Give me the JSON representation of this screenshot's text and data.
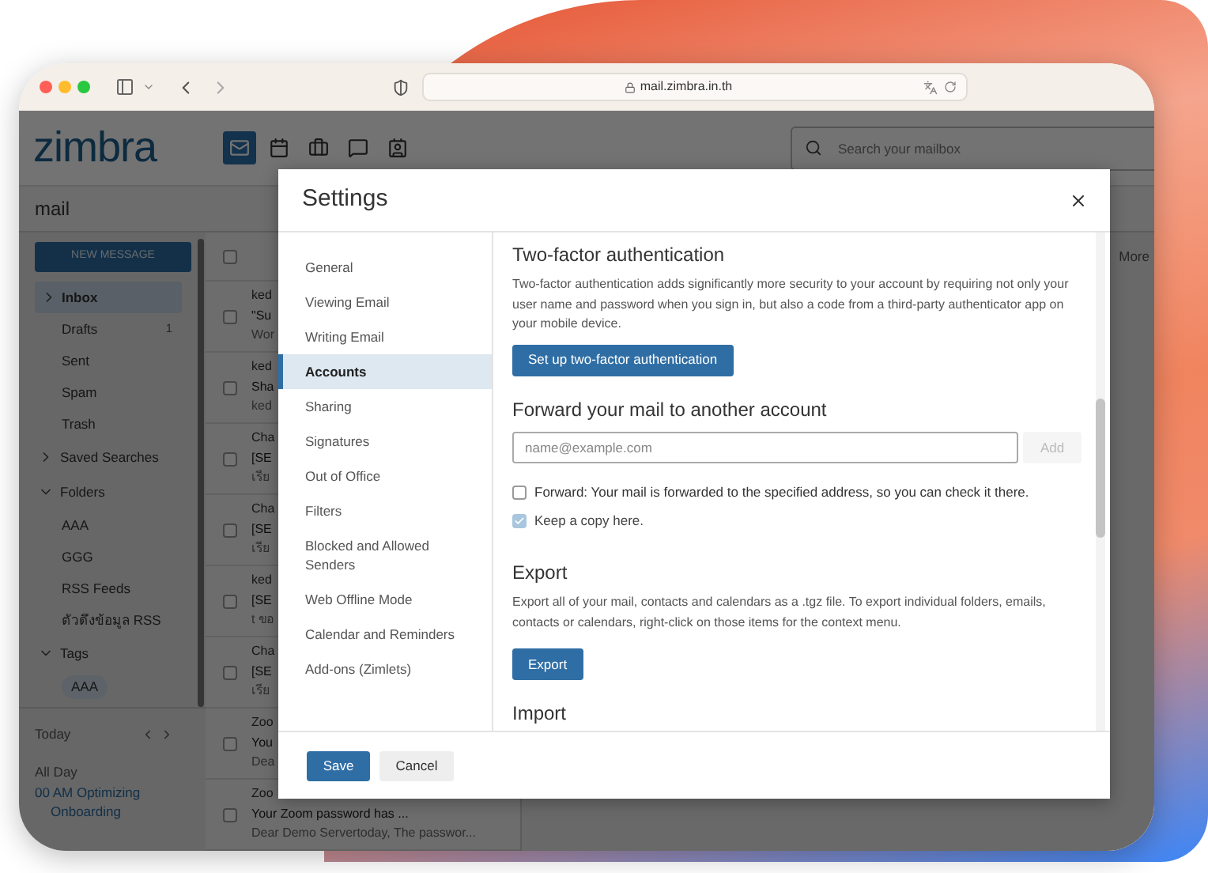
{
  "browser": {
    "url": "mail.zimbra.in.th"
  },
  "app": {
    "logo": "zimbra",
    "apps": [
      {
        "kind": "mail",
        "selected": true
      },
      {
        "kind": "calendar",
        "selected": false
      },
      {
        "kind": "briefcase",
        "selected": false
      },
      {
        "kind": "chat",
        "selected": false
      },
      {
        "kind": "contacts",
        "selected": false
      }
    ],
    "search": {
      "placeholder": "Search your mailbox"
    },
    "section_title": "mail"
  },
  "sidebar": {
    "new_message": "NEW MESSAGE",
    "folders": [
      {
        "label": "Inbox",
        "selected": true,
        "expanded": false
      },
      {
        "label": "Drafts",
        "selected": false,
        "count": "1"
      },
      {
        "label": "Sent",
        "selected": false
      },
      {
        "label": "Spam",
        "selected": false
      },
      {
        "label": "Trash",
        "selected": false
      }
    ],
    "groups": [
      {
        "label": "Saved Searches",
        "expanded": false
      },
      {
        "label": "Folders",
        "expanded": true,
        "children": [
          {
            "label": "AAA",
            "kind": "folder"
          },
          {
            "label": "GGG",
            "kind": "folder"
          },
          {
            "label": "RSS Feeds",
            "kind": "folder"
          },
          {
            "label": "ตัวดึงข้อมูล RSS",
            "kind": "folder"
          }
        ]
      },
      {
        "label": "Tags",
        "expanded": true,
        "children": [
          {
            "label": "AAA",
            "kind": "tag"
          }
        ]
      }
    ],
    "calendar": {
      "title": "Today",
      "all_day": "All Day",
      "event_lines": [
        "00 AM Optimizing",
        "Onboarding"
      ]
    }
  },
  "message_list": {
    "select_all_checked": false,
    "rows": [
      {
        "checked": false,
        "sender": "ked",
        "subject": "\"Su",
        "preview": "Wor"
      },
      {
        "checked": false,
        "sender": "ked",
        "subject": "Sha",
        "preview": "ked"
      },
      {
        "checked": false,
        "sender": "Cha",
        "subject": "[SE",
        "preview": "เรีย"
      },
      {
        "checked": false,
        "sender": "Cha",
        "subject": "[SE",
        "preview": "เรีย"
      },
      {
        "checked": false,
        "sender": "ked",
        "subject": "[SE",
        "preview": "t ขอ"
      },
      {
        "checked": false,
        "sender": "Cha",
        "subject": "[SE",
        "preview": "เรีย"
      },
      {
        "checked": false,
        "sender": "Zoo",
        "subject": "You",
        "preview": "Dea"
      },
      {
        "checked": false,
        "sender": "Zoo",
        "subject": "Your Zoom password has ...",
        "preview": "Dear Demo Servertoday, The passwor..."
      }
    ]
  },
  "reading_pane": {
    "toolbar_label": "More"
  },
  "settings": {
    "title": "Settings",
    "nav": [
      {
        "label": "General",
        "selected": false
      },
      {
        "label": "Viewing Email",
        "selected": false
      },
      {
        "label": "Writing Email",
        "selected": false
      },
      {
        "label": "Accounts",
        "selected": true
      },
      {
        "label": "Sharing",
        "selected": false
      },
      {
        "label": "Signatures",
        "selected": false
      },
      {
        "label": "Out of Office",
        "selected": false
      },
      {
        "label": "Filters",
        "selected": false
      },
      {
        "label": "Blocked and Allowed Senders",
        "selected": false
      },
      {
        "label": "Web Offline Mode",
        "selected": false
      },
      {
        "label": "Calendar and Reminders",
        "selected": false
      },
      {
        "label": "Add-ons (Zimlets)",
        "selected": false
      }
    ],
    "sections": [
      {
        "kind": "info",
        "title": "Two-factor authentication",
        "description": "Two-factor authentication adds significantly more security to your account by requiring not only your user name and password when you sign in, but also a code from a third-party authenticator app on your mobile device.",
        "button": "Set up two-factor authentication"
      },
      {
        "kind": "forward",
        "title": "Forward your mail to another account",
        "placeholder": "name@example.com",
        "add_button": "Add",
        "add_disabled": true,
        "options": [
          {
            "label": "Forward: Your mail is forwarded to the specified address, so you can check it there.",
            "checked": false,
            "disabled": false
          },
          {
            "label": "Keep a copy here.",
            "checked": true,
            "disabled": true
          }
        ]
      },
      {
        "kind": "info",
        "title": "Export",
        "description": "Export all of your mail, contacts and calendars as a .tgz file. To export individual folders, emails, contacts or calendars, right-click on those items for the context menu.",
        "button": "Export"
      },
      {
        "kind": "heading",
        "title": "Import"
      }
    ],
    "footer": {
      "save": "Save",
      "cancel": "Cancel"
    }
  }
}
